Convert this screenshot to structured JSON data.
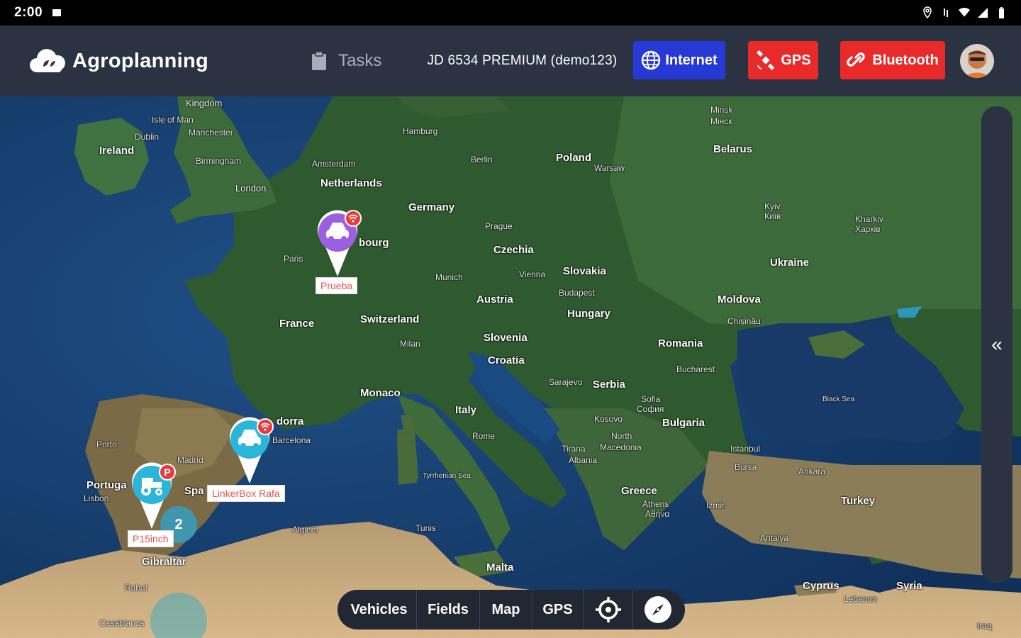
{
  "status_bar": {
    "time": "2:00"
  },
  "header": {
    "brand": "Agroplanning",
    "tasks_label": "Tasks",
    "vehicle_name": "JD 6534 PREMIUM (demo123)",
    "internet_label": "Internet",
    "gps_label": "GPS",
    "bluetooth_label": "Bluetooth",
    "colors": {
      "header_bg": "#2b3342",
      "internet": "#2639d6",
      "alert": "#e82a2a"
    }
  },
  "map": {
    "labels": {
      "kingdom": "Kingdom",
      "isle_of_man": "Isle of Man",
      "dublin": "Dublin",
      "manchester": "Manchester",
      "ireland": "Ireland",
      "birmingham": "Birmingham",
      "london": "London",
      "hamburg": "Hamburg",
      "amsterdam": "Amsterdam",
      "netherlands": "Netherlands",
      "berlin": "Berlin",
      "poland": "Poland",
      "warsaw": "Warsaw",
      "minsk": "Minsk",
      "minsk_local": "Мінск",
      "belarus": "Belarus",
      "germany": "Germany",
      "prague": "Prague",
      "czechia": "Czechia",
      "kyiv": "Kyiv",
      "kyiv_local": "Київ",
      "kharkiv": "Kharkiv",
      "kharkiv_local": "Харків",
      "ukraine": "Ukraine",
      "paris": "Paris",
      "luxembourg_part": "bourg",
      "munich": "Munich",
      "vienna": "Vienna",
      "slovakia": "Slovakia",
      "budapest": "Budapest",
      "austria": "Austria",
      "hungary": "Hungary",
      "moldova": "Moldova",
      "chisinau": "Chișinău",
      "france": "France",
      "switzerland": "Switzerland",
      "milan": "Milan",
      "slovenia": "Slovenia",
      "romania": "Romania",
      "croatia": "Croatia",
      "bucharest": "Bucharest",
      "black_sea": "Black Sea",
      "monaco": "Monaco",
      "sarajevo": "Sarajevo",
      "serbia": "Serbia",
      "sofia": "Sofia",
      "sofia_local": "София",
      "italy": "Italy",
      "andorra_part": "dorra",
      "barcelona": "Barcelona",
      "kosovo": "Kosovo",
      "bulgaria": "Bulgaria",
      "porto": "Porto",
      "madrid": "Madrid",
      "rome": "Rome",
      "north": "North",
      "macedonia": "Macedonia",
      "tirana": "Tirana",
      "albania": "Albania",
      "istanbul": "Istanbul",
      "bursa": "Bursa",
      "ankara": "Ankara",
      "portugal_part": "Portuga",
      "lisbon": "Lisbon",
      "spain_part": "Spa",
      "tyrrhenian": "Tyrrhenian Sea",
      "greece": "Greece",
      "athens": "Athens",
      "athens_local": "Αθήνα",
      "izmir": "İzmir",
      "turkey": "Turkey",
      "algiers": "Algiers",
      "tunis": "Tunis",
      "antalya": "Antalya",
      "gibraltar": "Gibraltar",
      "malta": "Malta",
      "cyprus": "Cyprus",
      "syria": "Syria",
      "rabat": "Rabat",
      "lebanon": "Lebanon",
      "casablanca": "Casablanca",
      "iraq": "Iraq"
    },
    "markers": [
      {
        "name": "Prueba",
        "color": "#9b5fe0",
        "badge_color": "#e83c3c"
      },
      {
        "name": "LinkerBox Rafa",
        "color": "#2bb5d8",
        "badge_color": "#e83c3c"
      },
      {
        "name": "P15inch",
        "color": "#2bb5d8",
        "badge": "P",
        "badge_color": "#e83c3c"
      }
    ],
    "cluster_count": "2"
  },
  "drawer": {
    "toggle_glyph": "«"
  },
  "toolbar": {
    "vehicles": "Vehicles",
    "fields": "Fields",
    "map": "Map",
    "gps": "GPS"
  }
}
